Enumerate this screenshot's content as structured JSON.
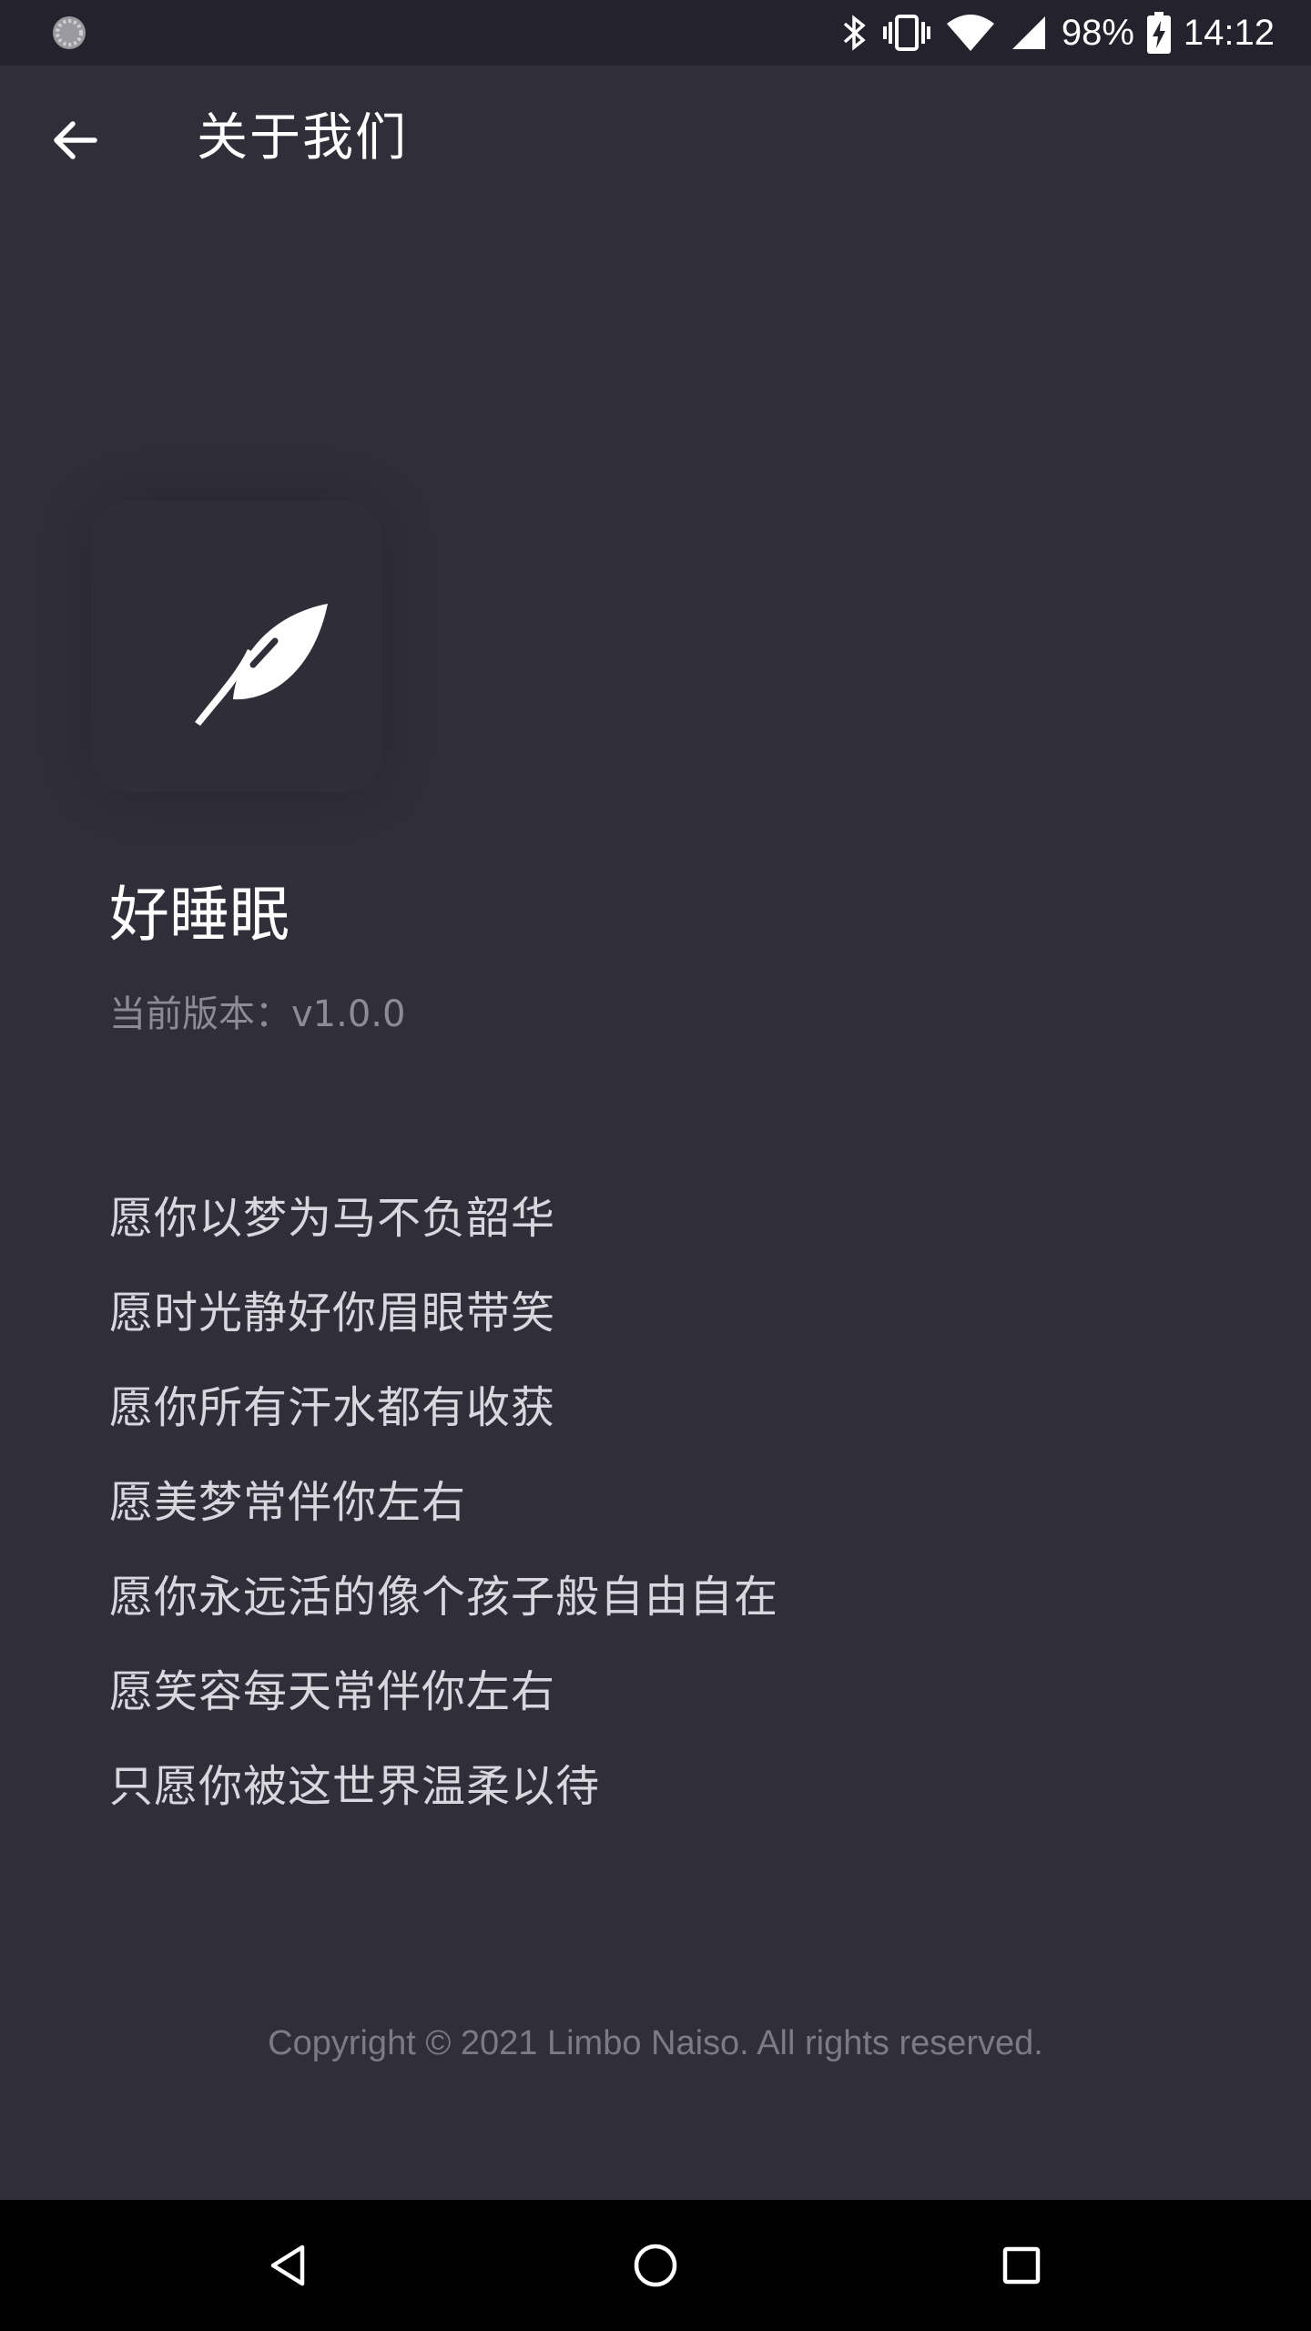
{
  "status_bar": {
    "battery_percent": "98%",
    "time": "14:12",
    "icons": [
      "loading-icon",
      "bluetooth-icon",
      "vibrate-icon",
      "wifi-icon",
      "signal-icon",
      "battery-charging-icon"
    ]
  },
  "app_bar": {
    "back_icon": "arrow-left-icon",
    "title": "关于我们"
  },
  "about": {
    "logo_icon": "feather-leaf-icon",
    "app_name": "好睡眠",
    "version": "当前版本：v1.0.0",
    "quotes": [
      "愿你以梦为马不负韶华",
      "愿时光静好你眉眼带笑",
      "愿你所有汗水都有收获",
      "愿美梦常伴你左右",
      "愿你永远活的像个孩子般自由自在",
      "愿笑容每天常伴你左右",
      "只愿你被这世界温柔以待"
    ],
    "copyright": "Copyright © 2021 Limbo Naiso. All rights reserved."
  },
  "nav_bar": {
    "icons": [
      "back-triangle-icon",
      "home-circle-icon",
      "recents-square-icon"
    ]
  },
  "colors": {
    "background": "#302e39",
    "status_bar": "#24222c",
    "text_primary": "#ffffff",
    "text_secondary": "#8d8b95"
  }
}
